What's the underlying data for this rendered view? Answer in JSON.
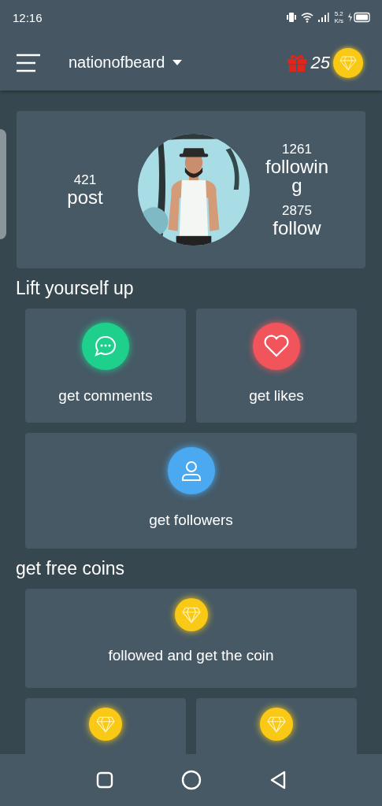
{
  "status_bar": {
    "time": "12:16",
    "speed_value": "5.2",
    "speed_unit": "K/s"
  },
  "header": {
    "username": "nationofbeard",
    "gift_count": "25"
  },
  "profile": {
    "left_stats": [
      {
        "value": "421",
        "label": "post"
      }
    ],
    "right_stats": [
      {
        "value": "1261",
        "label": "following"
      },
      {
        "value": "2875",
        "label": "follow"
      }
    ]
  },
  "sections": [
    {
      "title": "Lift yourself up",
      "cards": [
        {
          "label": "get comments",
          "kind": "comment",
          "wide": false
        },
        {
          "label": "get likes",
          "kind": "like",
          "wide": false
        },
        {
          "label": "get followers",
          "kind": "follower",
          "wide": true
        }
      ]
    },
    {
      "title": "get free coins",
      "cards": [
        {
          "label": "followed and get the coin",
          "kind": "coin",
          "wide": true
        },
        {
          "kind": "coin",
          "wide": false
        },
        {
          "kind": "coin",
          "wide": false
        }
      ]
    }
  ]
}
